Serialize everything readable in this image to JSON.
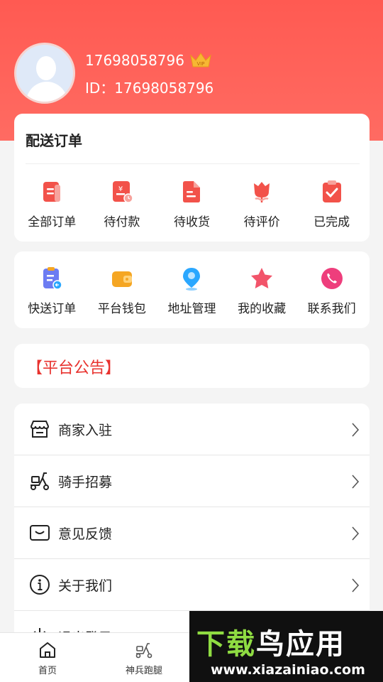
{
  "profile": {
    "phone": "17698058796",
    "id_text": "ID：17698058796",
    "badge": "VIP"
  },
  "orders": {
    "title": "配送订单",
    "items": [
      {
        "label": "全部订单",
        "icon": "order-list-icon"
      },
      {
        "label": "待付款",
        "icon": "payment-pending-icon"
      },
      {
        "label": "待收货",
        "icon": "delivery-pending-icon"
      },
      {
        "label": "待评价",
        "icon": "review-pending-icon"
      },
      {
        "label": "已完成",
        "icon": "completed-icon"
      }
    ]
  },
  "services": {
    "items": [
      {
        "label": "快送订单",
        "icon": "express-order-icon"
      },
      {
        "label": "平台钱包",
        "icon": "wallet-icon"
      },
      {
        "label": "地址管理",
        "icon": "location-icon"
      },
      {
        "label": "我的收藏",
        "icon": "star-icon"
      },
      {
        "label": "联系我们",
        "icon": "phone-icon"
      }
    ]
  },
  "notice": {
    "title": "【平台公告】"
  },
  "menu": {
    "items": [
      {
        "label": "商家入驻",
        "icon": "store-icon"
      },
      {
        "label": "骑手招募",
        "icon": "scooter-icon"
      },
      {
        "label": "意见反馈",
        "icon": "feedback-icon"
      },
      {
        "label": "关于我们",
        "icon": "info-icon"
      },
      {
        "label": "退出登录",
        "icon": "power-icon"
      }
    ]
  },
  "tabbar": {
    "items": [
      {
        "label": "首页",
        "icon": "home-icon"
      },
      {
        "label": "神兵跑腿",
        "icon": "scooter-icon"
      }
    ]
  },
  "watermark": {
    "title_part1": "下载",
    "title_part2": "鸟",
    "title_part3": "应用",
    "url": "www.xiazainiao.com"
  },
  "colors": {
    "header": "#ff5a52",
    "accent_red": "#f2524a",
    "notice_red": "#e8322e",
    "wallet_orange": "#f5a623",
    "location_blue": "#2aa7ff",
    "star_pink": "#f2546a",
    "phone_pink": "#ee3e7c"
  }
}
